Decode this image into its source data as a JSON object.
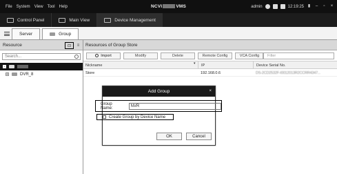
{
  "menu": {
    "items": [
      "File",
      "System",
      "View",
      "Tool",
      "Help"
    ],
    "app_title_prefix": "NCVI",
    "app_title_suffix": "VMS",
    "user": "admin",
    "clock": "12:19:25"
  },
  "top_tabs": [
    {
      "label": "Control Panel",
      "icon": "control-panel-icon"
    },
    {
      "label": "Main View",
      "icon": "main-view-icon"
    },
    {
      "label": "Device Management",
      "icon": "device-management-icon"
    }
  ],
  "sub_tabs": [
    {
      "label": "Server",
      "icon": "server-icon"
    },
    {
      "label": "Group",
      "icon": "group-icon"
    }
  ],
  "resource_panel": {
    "title": "Resource",
    "search_placeholder": "Search...",
    "tree": [
      {
        "label": "",
        "selected": true
      },
      {
        "label": "DVR_8",
        "selected": false
      }
    ]
  },
  "group_panel": {
    "title": "Resources of Group Store",
    "buttons": {
      "import": "Import",
      "modify": "Modify",
      "delete": "Delete",
      "remote_config": "Remote Config",
      "vca_config": "VCA Config"
    },
    "filter_placeholder": "Filter",
    "columns": [
      "Nickname",
      "IP",
      "Device Serial No."
    ],
    "rows": [
      {
        "nickname": "Store",
        "ip": "192.168.0.6",
        "serial": "DS-2CD2532F-I0012013R2CCRR4347..."
      }
    ]
  },
  "dialog": {
    "title": "Add Group",
    "group_name_label": "Group Name:",
    "group_name_value": "NVR",
    "create_by_device_label": "Create Group by Device Name",
    "ok": "OK",
    "cancel": "Cancel"
  }
}
